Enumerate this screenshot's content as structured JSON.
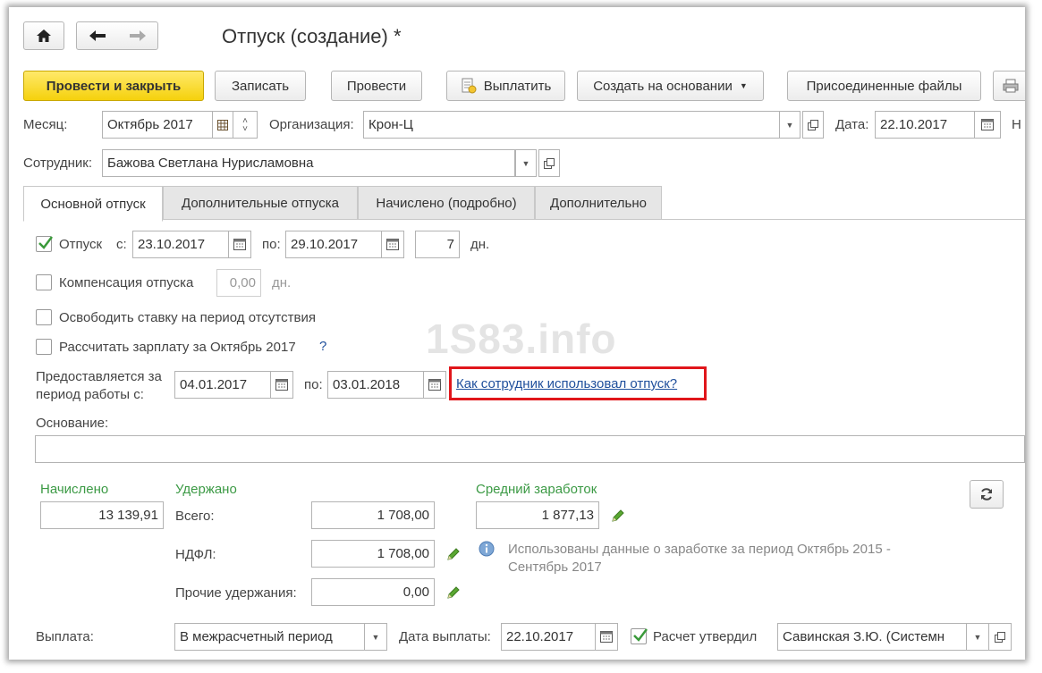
{
  "window": {
    "title": "Отпуск (создание) *"
  },
  "nav": {
    "home_icon": "home-icon",
    "back_icon": "arrow-left-icon",
    "forward_icon": "arrow-right-icon"
  },
  "toolbar": {
    "post_close": "Провести и закрыть",
    "save": "Записать",
    "post": "Провести",
    "pay": "Выплатить",
    "create_based": "Создать на основании",
    "attached_files": "Присоединенные файлы"
  },
  "header": {
    "month_label": "Месяц:",
    "month_value": "Октябрь 2017",
    "org_label": "Организация:",
    "org_value": "Крон-Ц",
    "date_label": "Дата:",
    "date_value": "22.10.2017",
    "cut_label": "Н",
    "employee_label": "Сотрудник:",
    "employee_value": "Бажова Светлана Нурисламовна"
  },
  "tabs": [
    "Основной отпуск",
    "Дополнительные отпуска",
    "Начислено (подробно)",
    "Дополнительно"
  ],
  "vacation": {
    "label": "Отпуск",
    "from_label": "с:",
    "from_value": "23.10.2017",
    "to_label": "по:",
    "to_value": "29.10.2017",
    "days_value": "7",
    "days_unit": "дн."
  },
  "compensation": {
    "label": "Компенсация отпуска",
    "value": "0,00",
    "unit": "дн."
  },
  "release_rate": {
    "label": "Освободить ставку на период отсутствия"
  },
  "calc_salary": {
    "label": "Рассчитать зарплату за Октябрь 2017",
    "help": "?"
  },
  "period": {
    "label_line1": "Предоставляется за",
    "label_line2": "период работы с:",
    "from_value": "04.01.2017",
    "to_label": "по:",
    "to_value": "03.01.2018",
    "link": "Как сотрудник использовал отпуск?"
  },
  "basis": {
    "label": "Основание:",
    "value": ""
  },
  "watermark": "1S83.info",
  "totals": {
    "accrued_header": "Начислено",
    "accrued_value": "13 139,91",
    "withheld_header": "Удержано",
    "total_label": "Всего:",
    "total_value": "1 708,00",
    "ndfl_label": "НДФЛ:",
    "ndfl_value": "1 708,00",
    "other_label": "Прочие удержания:",
    "other_value": "0,00",
    "avg_header": "Средний заработок",
    "avg_value": "1 877,13",
    "info_line1": "Использованы данные о заработке за период Октябрь 2015 -",
    "info_line2": "Сентябрь 2017"
  },
  "payment": {
    "label": "Выплата:",
    "value": "В межрасчетный период",
    "date_label": "Дата выплаты:",
    "date_value": "22.10.2017",
    "approved_label": "Расчет утвердил",
    "approver_value": "Савинская З.Ю. (Системн"
  },
  "colors": {
    "accent_green": "#3c9a45",
    "link_blue": "#1f4f9c",
    "highlight_red": "#e0161b",
    "primary_yellow": "#f5d10c"
  }
}
